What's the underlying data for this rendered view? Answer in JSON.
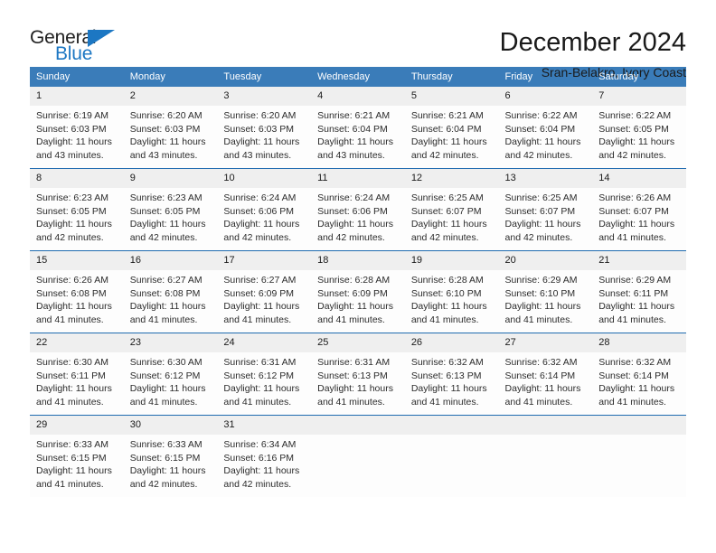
{
  "logo": {
    "name_part1": "General",
    "name_part2": "Blue",
    "icon": "triangle-icon",
    "color_primary": "#1c77c3",
    "color_text": "#222222"
  },
  "header": {
    "title": "December 2024",
    "subtitle": "Sran-Belakro, Ivory Coast"
  },
  "theme": {
    "header_blue": "#3a7cb9",
    "separator_blue": "#1f6bb0",
    "daynum_gray": "#efefef"
  },
  "calendar": {
    "weekday_headers": [
      "Sunday",
      "Monday",
      "Tuesday",
      "Wednesday",
      "Thursday",
      "Friday",
      "Saturday"
    ],
    "weeks": [
      [
        {
          "day": "1",
          "sunrise": "Sunrise: 6:19 AM",
          "sunset": "Sunset: 6:03 PM",
          "daylight_line1": "Daylight: 11 hours",
          "daylight_line2": "and 43 minutes."
        },
        {
          "day": "2",
          "sunrise": "Sunrise: 6:20 AM",
          "sunset": "Sunset: 6:03 PM",
          "daylight_line1": "Daylight: 11 hours",
          "daylight_line2": "and 43 minutes."
        },
        {
          "day": "3",
          "sunrise": "Sunrise: 6:20 AM",
          "sunset": "Sunset: 6:03 PM",
          "daylight_line1": "Daylight: 11 hours",
          "daylight_line2": "and 43 minutes."
        },
        {
          "day": "4",
          "sunrise": "Sunrise: 6:21 AM",
          "sunset": "Sunset: 6:04 PM",
          "daylight_line1": "Daylight: 11 hours",
          "daylight_line2": "and 43 minutes."
        },
        {
          "day": "5",
          "sunrise": "Sunrise: 6:21 AM",
          "sunset": "Sunset: 6:04 PM",
          "daylight_line1": "Daylight: 11 hours",
          "daylight_line2": "and 42 minutes."
        },
        {
          "day": "6",
          "sunrise": "Sunrise: 6:22 AM",
          "sunset": "Sunset: 6:04 PM",
          "daylight_line1": "Daylight: 11 hours",
          "daylight_line2": "and 42 minutes."
        },
        {
          "day": "7",
          "sunrise": "Sunrise: 6:22 AM",
          "sunset": "Sunset: 6:05 PM",
          "daylight_line1": "Daylight: 11 hours",
          "daylight_line2": "and 42 minutes."
        }
      ],
      [
        {
          "day": "8",
          "sunrise": "Sunrise: 6:23 AM",
          "sunset": "Sunset: 6:05 PM",
          "daylight_line1": "Daylight: 11 hours",
          "daylight_line2": "and 42 minutes."
        },
        {
          "day": "9",
          "sunrise": "Sunrise: 6:23 AM",
          "sunset": "Sunset: 6:05 PM",
          "daylight_line1": "Daylight: 11 hours",
          "daylight_line2": "and 42 minutes."
        },
        {
          "day": "10",
          "sunrise": "Sunrise: 6:24 AM",
          "sunset": "Sunset: 6:06 PM",
          "daylight_line1": "Daylight: 11 hours",
          "daylight_line2": "and 42 minutes."
        },
        {
          "day": "11",
          "sunrise": "Sunrise: 6:24 AM",
          "sunset": "Sunset: 6:06 PM",
          "daylight_line1": "Daylight: 11 hours",
          "daylight_line2": "and 42 minutes."
        },
        {
          "day": "12",
          "sunrise": "Sunrise: 6:25 AM",
          "sunset": "Sunset: 6:07 PM",
          "daylight_line1": "Daylight: 11 hours",
          "daylight_line2": "and 42 minutes."
        },
        {
          "day": "13",
          "sunrise": "Sunrise: 6:25 AM",
          "sunset": "Sunset: 6:07 PM",
          "daylight_line1": "Daylight: 11 hours",
          "daylight_line2": "and 42 minutes."
        },
        {
          "day": "14",
          "sunrise": "Sunrise: 6:26 AM",
          "sunset": "Sunset: 6:07 PM",
          "daylight_line1": "Daylight: 11 hours",
          "daylight_line2": "and 41 minutes."
        }
      ],
      [
        {
          "day": "15",
          "sunrise": "Sunrise: 6:26 AM",
          "sunset": "Sunset: 6:08 PM",
          "daylight_line1": "Daylight: 11 hours",
          "daylight_line2": "and 41 minutes."
        },
        {
          "day": "16",
          "sunrise": "Sunrise: 6:27 AM",
          "sunset": "Sunset: 6:08 PM",
          "daylight_line1": "Daylight: 11 hours",
          "daylight_line2": "and 41 minutes."
        },
        {
          "day": "17",
          "sunrise": "Sunrise: 6:27 AM",
          "sunset": "Sunset: 6:09 PM",
          "daylight_line1": "Daylight: 11 hours",
          "daylight_line2": "and 41 minutes."
        },
        {
          "day": "18",
          "sunrise": "Sunrise: 6:28 AM",
          "sunset": "Sunset: 6:09 PM",
          "daylight_line1": "Daylight: 11 hours",
          "daylight_line2": "and 41 minutes."
        },
        {
          "day": "19",
          "sunrise": "Sunrise: 6:28 AM",
          "sunset": "Sunset: 6:10 PM",
          "daylight_line1": "Daylight: 11 hours",
          "daylight_line2": "and 41 minutes."
        },
        {
          "day": "20",
          "sunrise": "Sunrise: 6:29 AM",
          "sunset": "Sunset: 6:10 PM",
          "daylight_line1": "Daylight: 11 hours",
          "daylight_line2": "and 41 minutes."
        },
        {
          "day": "21",
          "sunrise": "Sunrise: 6:29 AM",
          "sunset": "Sunset: 6:11 PM",
          "daylight_line1": "Daylight: 11 hours",
          "daylight_line2": "and 41 minutes."
        }
      ],
      [
        {
          "day": "22",
          "sunrise": "Sunrise: 6:30 AM",
          "sunset": "Sunset: 6:11 PM",
          "daylight_line1": "Daylight: 11 hours",
          "daylight_line2": "and 41 minutes."
        },
        {
          "day": "23",
          "sunrise": "Sunrise: 6:30 AM",
          "sunset": "Sunset: 6:12 PM",
          "daylight_line1": "Daylight: 11 hours",
          "daylight_line2": "and 41 minutes."
        },
        {
          "day": "24",
          "sunrise": "Sunrise: 6:31 AM",
          "sunset": "Sunset: 6:12 PM",
          "daylight_line1": "Daylight: 11 hours",
          "daylight_line2": "and 41 minutes."
        },
        {
          "day": "25",
          "sunrise": "Sunrise: 6:31 AM",
          "sunset": "Sunset: 6:13 PM",
          "daylight_line1": "Daylight: 11 hours",
          "daylight_line2": "and 41 minutes."
        },
        {
          "day": "26",
          "sunrise": "Sunrise: 6:32 AM",
          "sunset": "Sunset: 6:13 PM",
          "daylight_line1": "Daylight: 11 hours",
          "daylight_line2": "and 41 minutes."
        },
        {
          "day": "27",
          "sunrise": "Sunrise: 6:32 AM",
          "sunset": "Sunset: 6:14 PM",
          "daylight_line1": "Daylight: 11 hours",
          "daylight_line2": "and 41 minutes."
        },
        {
          "day": "28",
          "sunrise": "Sunrise: 6:32 AM",
          "sunset": "Sunset: 6:14 PM",
          "daylight_line1": "Daylight: 11 hours",
          "daylight_line2": "and 41 minutes."
        }
      ],
      [
        {
          "day": "29",
          "sunrise": "Sunrise: 6:33 AM",
          "sunset": "Sunset: 6:15 PM",
          "daylight_line1": "Daylight: 11 hours",
          "daylight_line2": "and 41 minutes."
        },
        {
          "day": "30",
          "sunrise": "Sunrise: 6:33 AM",
          "sunset": "Sunset: 6:15 PM",
          "daylight_line1": "Daylight: 11 hours",
          "daylight_line2": "and 42 minutes."
        },
        {
          "day": "31",
          "sunrise": "Sunrise: 6:34 AM",
          "sunset": "Sunset: 6:16 PM",
          "daylight_line1": "Daylight: 11 hours",
          "daylight_line2": "and 42 minutes."
        },
        {
          "day": "",
          "sunrise": "",
          "sunset": "",
          "daylight_line1": "",
          "daylight_line2": ""
        },
        {
          "day": "",
          "sunrise": "",
          "sunset": "",
          "daylight_line1": "",
          "daylight_line2": ""
        },
        {
          "day": "",
          "sunrise": "",
          "sunset": "",
          "daylight_line1": "",
          "daylight_line2": ""
        },
        {
          "day": "",
          "sunrise": "",
          "sunset": "",
          "daylight_line1": "",
          "daylight_line2": ""
        }
      ]
    ]
  }
}
